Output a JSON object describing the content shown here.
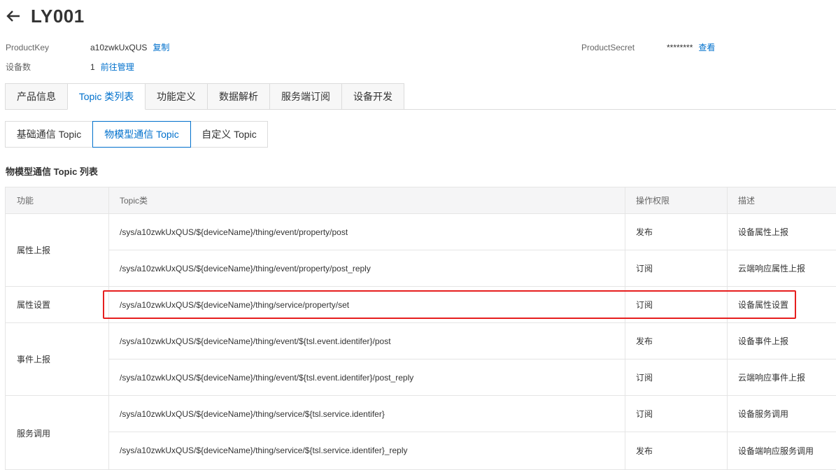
{
  "page": {
    "title": "LY001"
  },
  "meta": {
    "product_key_label": "ProductKey",
    "product_key_value": "a10zwkUxQUS",
    "copy_link": "复制",
    "device_count_label": "设备数",
    "device_count_value": "1",
    "manage_link": "前往管理",
    "product_secret_label": "ProductSecret",
    "product_secret_value": "********",
    "view_link": "查看"
  },
  "tabs": [
    {
      "label": "产品信息",
      "active": false
    },
    {
      "label": "Topic 类列表",
      "active": true
    },
    {
      "label": "功能定义",
      "active": false
    },
    {
      "label": "数据解析",
      "active": false
    },
    {
      "label": "服务端订阅",
      "active": false
    },
    {
      "label": "设备开发",
      "active": false
    }
  ],
  "subtabs": [
    {
      "label": "基础通信 Topic",
      "active": false
    },
    {
      "label": "物模型通信 Topic",
      "active": true
    },
    {
      "label": "自定义 Topic",
      "active": false
    }
  ],
  "section_title": "物模型通信 Topic 列表",
  "table": {
    "headers": [
      "功能",
      "Topic类",
      "操作权限",
      "描述"
    ],
    "groups": [
      {
        "function": "属性上报",
        "rows": [
          {
            "topic": "/sys/a10zwkUxQUS/${deviceName}/thing/event/property/post",
            "permission": "发布",
            "description": "设备属性上报"
          },
          {
            "topic": "/sys/a10zwkUxQUS/${deviceName}/thing/event/property/post_reply",
            "permission": "订阅",
            "description": "云端响应属性上报"
          }
        ]
      },
      {
        "function": "属性设置",
        "rows": [
          {
            "topic": "/sys/a10zwkUxQUS/${deviceName}/thing/service/property/set",
            "permission": "订阅",
            "description": "设备属性设置"
          }
        ]
      },
      {
        "function": "事件上报",
        "rows": [
          {
            "topic": "/sys/a10zwkUxQUS/${deviceName}/thing/event/${tsl.event.identifer}/post",
            "permission": "发布",
            "description": "设备事件上报"
          },
          {
            "topic": "/sys/a10zwkUxQUS/${deviceName}/thing/event/${tsl.event.identifer}/post_reply",
            "permission": "订阅",
            "description": "云端响应事件上报"
          }
        ]
      },
      {
        "function": "服务调用",
        "rows": [
          {
            "topic": "/sys/a10zwkUxQUS/${deviceName}/thing/service/${tsl.service.identifer}",
            "permission": "订阅",
            "description": "设备服务调用"
          },
          {
            "topic": "/sys/a10zwkUxQUS/${deviceName}/thing/service/${tsl.service.identifer}_reply",
            "permission": "发布",
            "description": "设备端响应服务调用"
          }
        ]
      }
    ]
  },
  "colors": {
    "accent": "#0070cc",
    "highlight": "#e61e1e"
  }
}
